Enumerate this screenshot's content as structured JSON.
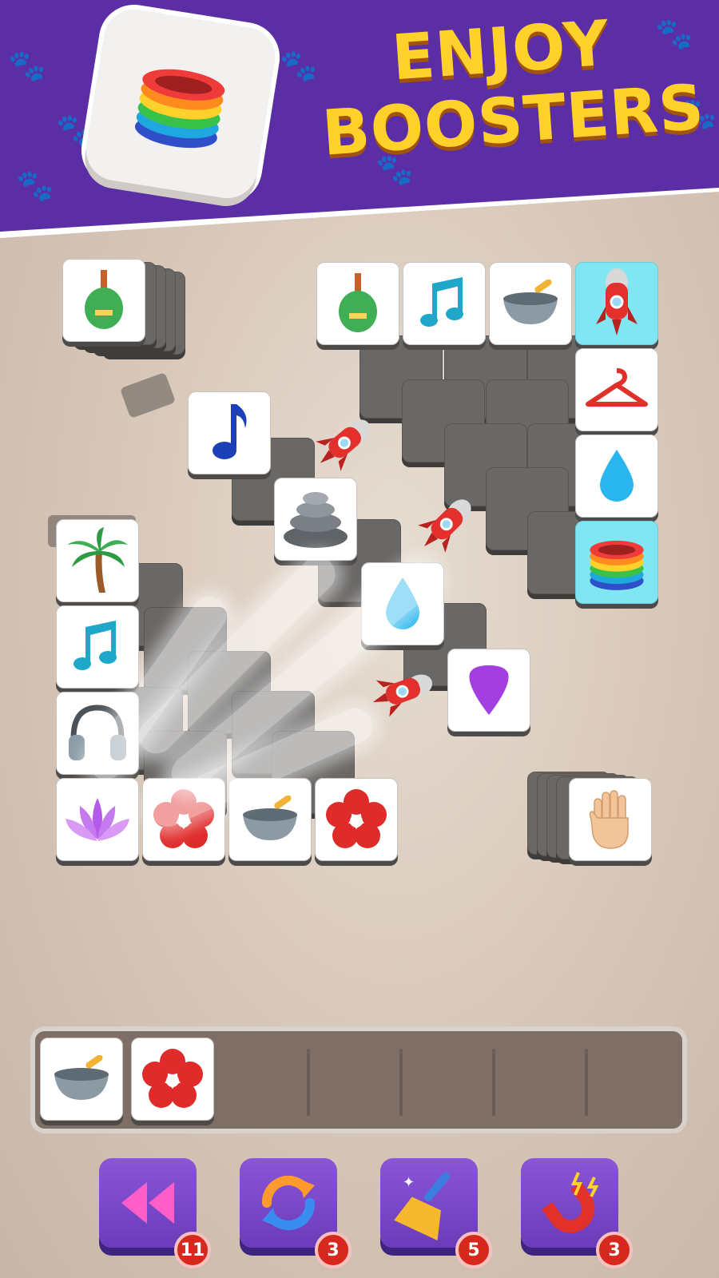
{
  "banner": {
    "title_line1": "ENJOY",
    "title_line2": "BOOSTERS",
    "featured_booster_icon": "rainbow-spring-icon"
  },
  "colors": {
    "banner_bg": "#5b2ea6",
    "title_yellow": "#ffd12a",
    "highlight_cyan": "#7fe6f2",
    "tray_bg": "#7f6e66",
    "button_purple": "#7a47c9",
    "badge_red": "#d7281e"
  },
  "board": {
    "top_icons": [
      "guitar-icon",
      "music-notes-icon",
      "mortar-pestle-icon",
      "rocket-icon"
    ],
    "left_column_icons": [
      "palm-tree-icon",
      "music-notes-icon",
      "headphones-icon",
      "lotus-icon"
    ],
    "bottom_row_icons": [
      "flower-icon",
      "mortar-pestle-icon",
      "flower-icon"
    ],
    "right_column_icons": [
      "hanger-icon",
      "water-drop-icon",
      "rainbow-spring-icon"
    ],
    "center_icons": [
      "music-note-icon",
      "stones-icon",
      "water-drop-icon",
      "guitar-pick-icon"
    ],
    "stack_left_icon": "guitar-icon",
    "stack_right_icon": "hand-icon",
    "flying_rockets": 4
  },
  "tray": {
    "slots_total": 7,
    "filled": [
      "mortar-pestle-icon",
      "flower-icon"
    ]
  },
  "boosters": [
    {
      "name": "undo",
      "icon": "rewind-icon",
      "count": "11"
    },
    {
      "name": "shuffle",
      "icon": "shuffle-icon",
      "count": "3"
    },
    {
      "name": "sweep",
      "icon": "broom-icon",
      "count": "5"
    },
    {
      "name": "magnet",
      "icon": "magnet-icon",
      "count": "3"
    }
  ]
}
